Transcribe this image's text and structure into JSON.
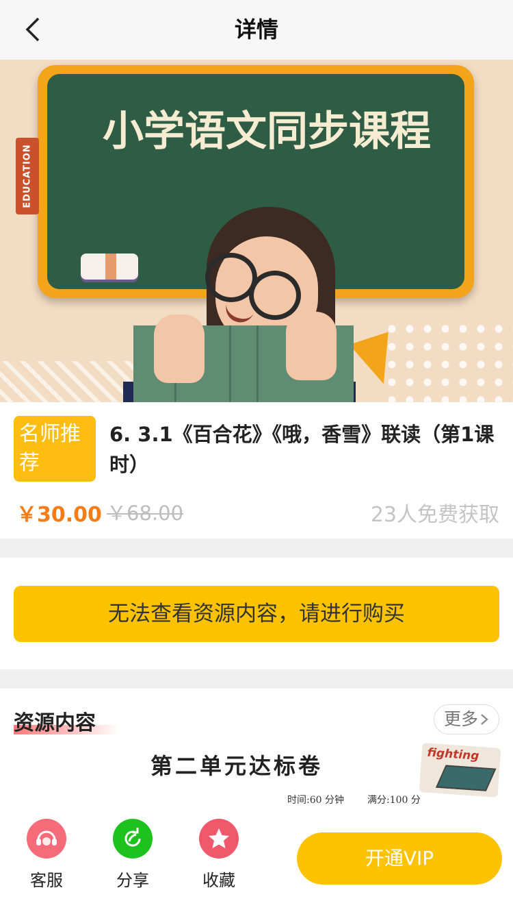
{
  "nav": {
    "title": "详情",
    "back_icon": "chevron-left-icon"
  },
  "banner": {
    "main_text": "小学语文同步课程",
    "tag_text": "EDUCATION"
  },
  "course": {
    "badge": "名师推荐",
    "title": "6. 3.1《百合花》《哦，香雪》联读（第1课时）",
    "price": "￥30.00",
    "original_price": "￥68.00",
    "free_count": "23人免费获取"
  },
  "purchase_notice": "无法查看资源内容，请进行购买",
  "resource": {
    "section_title": "资源内容",
    "more_label": "更多",
    "doc_title": "第二单元达标卷",
    "doc_time": "时间:60 分钟",
    "doc_score": "满分:100 分",
    "sticker_text": "fighting"
  },
  "bottom_bar": {
    "service_label": "客服",
    "share_label": "分享",
    "favorite_label": "收藏",
    "vip_label": "开通VIP"
  },
  "colors": {
    "accent_yellow": "#fdc300",
    "price_orange": "#f47b16",
    "service_pink": "#f56b7a",
    "share_green": "#1ec21e",
    "favorite_red": "#f0586b"
  }
}
